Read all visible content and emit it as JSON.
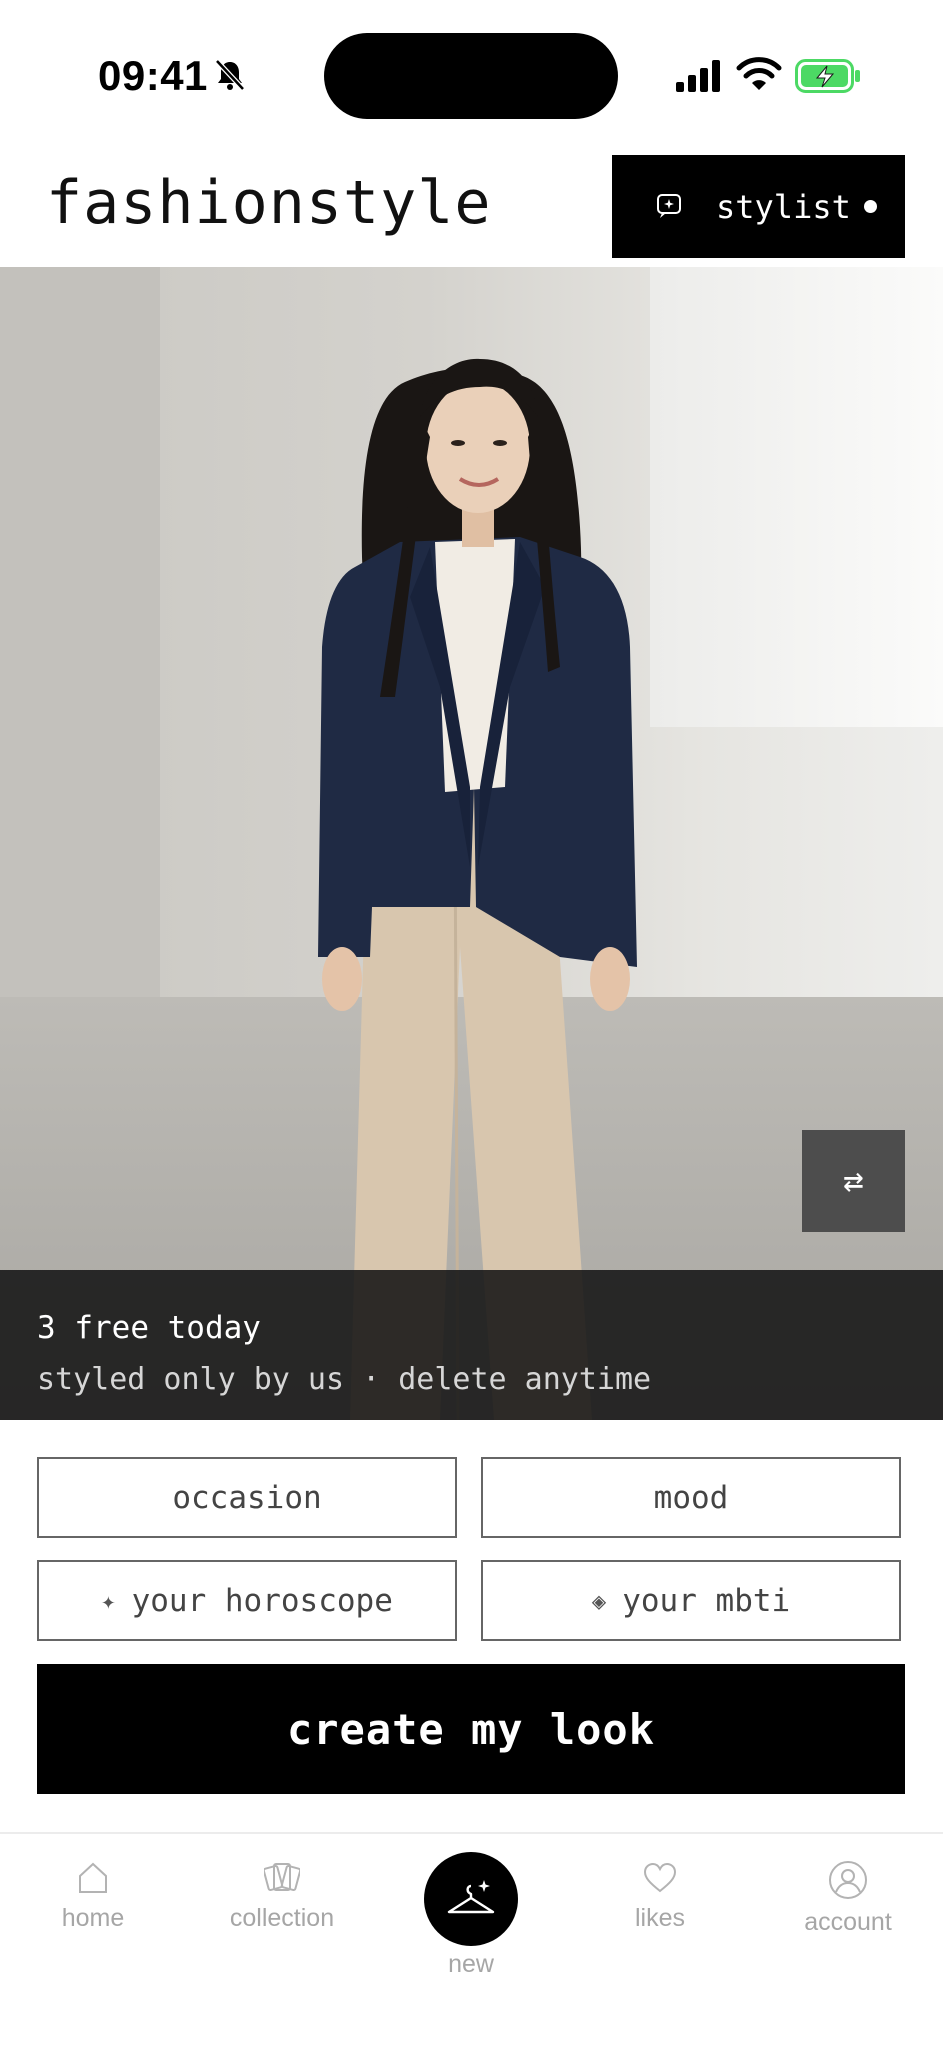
{
  "status_bar": {
    "time": "09:41"
  },
  "header": {
    "brand": "fashionstyle",
    "stylist_label": "stylist"
  },
  "hero": {
    "swap_symbol": "⇄",
    "promo_line1": "3 free today",
    "promo_line2": "styled only by us · delete anytime"
  },
  "options": {
    "occasion": "occasion",
    "mood": "mood",
    "horoscope_symbol": "✦",
    "horoscope": "your horoscope",
    "mbti_symbol": "◈",
    "mbti": "your mbti"
  },
  "cta": {
    "label": "create my look"
  },
  "nav": {
    "home": "home",
    "collection": "collection",
    "new": "new",
    "likes": "likes",
    "account": "account"
  },
  "icons": {
    "bell": "bell-slash-icon",
    "signal": "cellular-signal-icon",
    "wifi": "wifi-icon",
    "battery": "battery-charging-icon",
    "stylist": "chat-sparkle-icon",
    "swap": "swap-icon",
    "home": "home-icon",
    "collection": "cards-icon",
    "new": "hanger-sparkle-icon",
    "likes": "heart-icon",
    "account": "user-icon"
  },
  "colors": {
    "primary": "#000000",
    "battery": "#4cd964",
    "nav_text": "#a6a6a6",
    "blazer": "#1f2a44",
    "trousers": "#d8c6ae"
  }
}
